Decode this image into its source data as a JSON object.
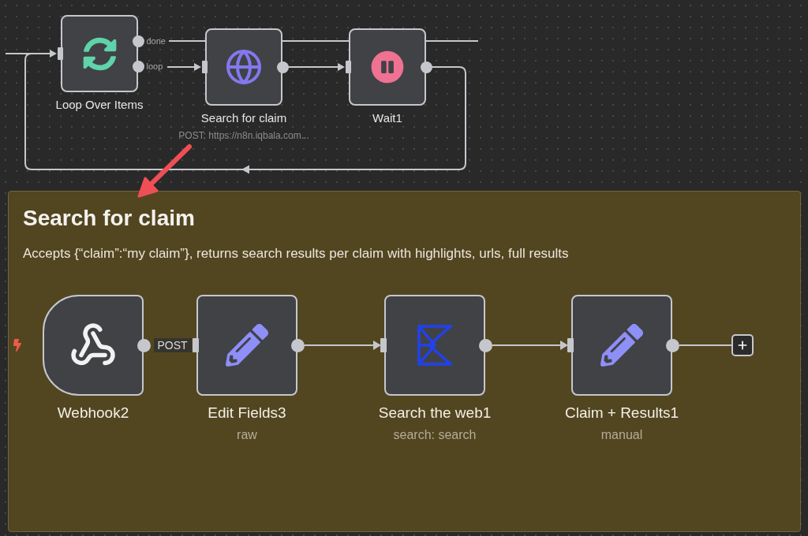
{
  "workflow": {
    "nodes": [
      {
        "kind": "loop",
        "name": "Loop Over Items",
        "outputs": [
          "done",
          "loop"
        ]
      },
      {
        "kind": "http",
        "name": "Search for claim",
        "subtitle": "POST: https://n8n.iqbala.com..."
      },
      {
        "kind": "wait",
        "name": "Wait1"
      }
    ]
  },
  "sticky_note": {
    "title": "Search for claim",
    "description": "Accepts {“claim”:“my claim”}, returns search results per claim with highlights, urls, full results",
    "nodes": [
      {
        "kind": "webhook",
        "name": "Webhook2",
        "output_label": "POST"
      },
      {
        "kind": "set",
        "name": "Edit Fields3",
        "subtitle": "raw"
      },
      {
        "kind": "search",
        "name": "Search the web1",
        "subtitle": "search: search"
      },
      {
        "kind": "set",
        "name": "Claim + Results1",
        "subtitle": "manual"
      }
    ]
  }
}
